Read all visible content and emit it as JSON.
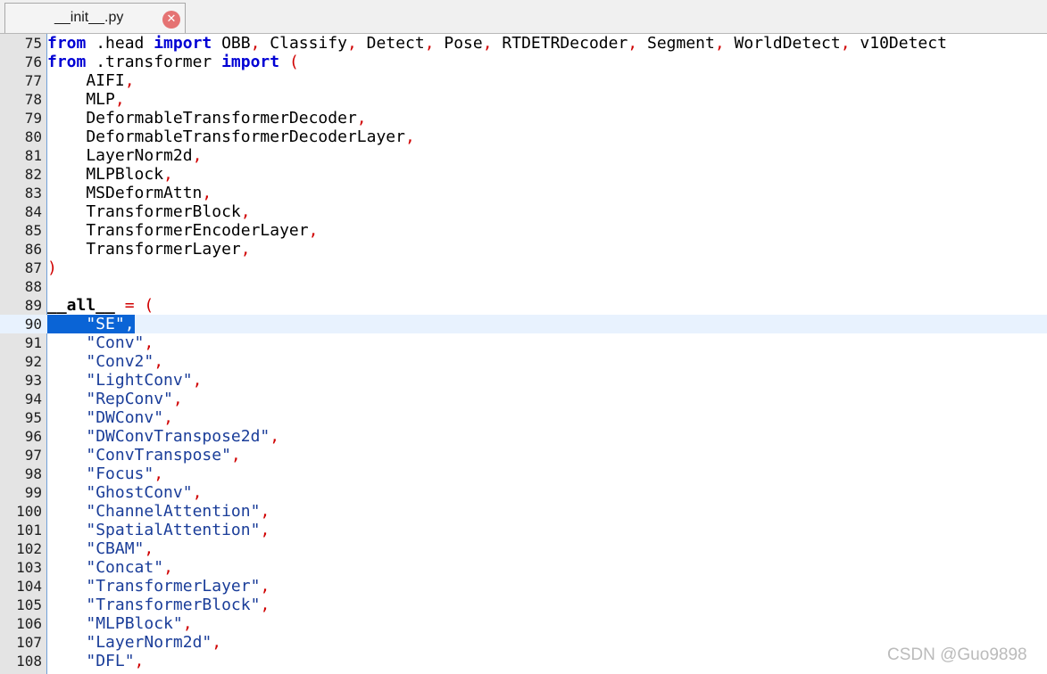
{
  "tab": {
    "title": "__init__.py",
    "close_glyph": "✕"
  },
  "lines": [
    {
      "n": "75",
      "tokens": [
        {
          "t": "from",
          "c": "kw"
        },
        {
          "t": " .head ",
          "c": ""
        },
        {
          "t": "import",
          "c": "kw"
        },
        {
          "t": " OBB",
          "c": ""
        },
        {
          "t": ",",
          "c": "op"
        },
        {
          "t": " Classify",
          "c": ""
        },
        {
          "t": ",",
          "c": "op"
        },
        {
          "t": " Detect",
          "c": ""
        },
        {
          "t": ",",
          "c": "op"
        },
        {
          "t": " Pose",
          "c": ""
        },
        {
          "t": ",",
          "c": "op"
        },
        {
          "t": " RTDETRDecoder",
          "c": ""
        },
        {
          "t": ",",
          "c": "op"
        },
        {
          "t": " Segment",
          "c": ""
        },
        {
          "t": ",",
          "c": "op"
        },
        {
          "t": " WorldDetect",
          "c": ""
        },
        {
          "t": ",",
          "c": "op"
        },
        {
          "t": " v10Detect",
          "c": ""
        }
      ]
    },
    {
      "n": "76",
      "tokens": [
        {
          "t": "from",
          "c": "kw"
        },
        {
          "t": " .transformer ",
          "c": ""
        },
        {
          "t": "import",
          "c": "kw"
        },
        {
          "t": " ",
          "c": ""
        },
        {
          "t": "(",
          "c": "op"
        }
      ]
    },
    {
      "n": "77",
      "tokens": [
        {
          "t": "    AIFI",
          "c": ""
        },
        {
          "t": ",",
          "c": "op"
        }
      ]
    },
    {
      "n": "78",
      "tokens": [
        {
          "t": "    MLP",
          "c": ""
        },
        {
          "t": ",",
          "c": "op"
        }
      ]
    },
    {
      "n": "79",
      "tokens": [
        {
          "t": "    DeformableTransformerDecoder",
          "c": ""
        },
        {
          "t": ",",
          "c": "op"
        }
      ]
    },
    {
      "n": "80",
      "tokens": [
        {
          "t": "    DeformableTransformerDecoderLayer",
          "c": ""
        },
        {
          "t": ",",
          "c": "op"
        }
      ]
    },
    {
      "n": "81",
      "tokens": [
        {
          "t": "    LayerNorm2d",
          "c": ""
        },
        {
          "t": ",",
          "c": "op"
        }
      ]
    },
    {
      "n": "82",
      "tokens": [
        {
          "t": "    MLPBlock",
          "c": ""
        },
        {
          "t": ",",
          "c": "op"
        }
      ]
    },
    {
      "n": "83",
      "tokens": [
        {
          "t": "    MSDeformAttn",
          "c": ""
        },
        {
          "t": ",",
          "c": "op"
        }
      ]
    },
    {
      "n": "84",
      "tokens": [
        {
          "t": "    TransformerBlock",
          "c": ""
        },
        {
          "t": ",",
          "c": "op"
        }
      ]
    },
    {
      "n": "85",
      "tokens": [
        {
          "t": "    TransformerEncoderLayer",
          "c": ""
        },
        {
          "t": ",",
          "c": "op"
        }
      ]
    },
    {
      "n": "86",
      "tokens": [
        {
          "t": "    TransformerLayer",
          "c": ""
        },
        {
          "t": ",",
          "c": "op"
        }
      ]
    },
    {
      "n": "87",
      "tokens": [
        {
          "t": ")",
          "c": "op"
        }
      ]
    },
    {
      "n": "88",
      "tokens": []
    },
    {
      "n": "89",
      "tokens": [
        {
          "t": "__all__",
          "c": "dunder"
        },
        {
          "t": " ",
          "c": ""
        },
        {
          "t": "=",
          "c": "op"
        },
        {
          "t": " ",
          "c": ""
        },
        {
          "t": "(",
          "c": "op"
        }
      ]
    },
    {
      "n": "90",
      "hl": true,
      "tokens": [
        {
          "t": "    \"SE\"",
          "c": "sel"
        },
        {
          "t": ",",
          "c": "sel op"
        }
      ]
    },
    {
      "n": "91",
      "tokens": [
        {
          "t": "    ",
          "c": ""
        },
        {
          "t": "\"Conv\"",
          "c": "str"
        },
        {
          "t": ",",
          "c": "op"
        }
      ]
    },
    {
      "n": "92",
      "tokens": [
        {
          "t": "    ",
          "c": ""
        },
        {
          "t": "\"Conv2\"",
          "c": "str"
        },
        {
          "t": ",",
          "c": "op"
        }
      ]
    },
    {
      "n": "93",
      "tokens": [
        {
          "t": "    ",
          "c": ""
        },
        {
          "t": "\"LightConv\"",
          "c": "str"
        },
        {
          "t": ",",
          "c": "op"
        }
      ]
    },
    {
      "n": "94",
      "tokens": [
        {
          "t": "    ",
          "c": ""
        },
        {
          "t": "\"RepConv\"",
          "c": "str"
        },
        {
          "t": ",",
          "c": "op"
        }
      ]
    },
    {
      "n": "95",
      "tokens": [
        {
          "t": "    ",
          "c": ""
        },
        {
          "t": "\"DWConv\"",
          "c": "str"
        },
        {
          "t": ",",
          "c": "op"
        }
      ]
    },
    {
      "n": "96",
      "tokens": [
        {
          "t": "    ",
          "c": ""
        },
        {
          "t": "\"DWConvTranspose2d\"",
          "c": "str"
        },
        {
          "t": ",",
          "c": "op"
        }
      ]
    },
    {
      "n": "97",
      "tokens": [
        {
          "t": "    ",
          "c": ""
        },
        {
          "t": "\"ConvTranspose\"",
          "c": "str"
        },
        {
          "t": ",",
          "c": "op"
        }
      ]
    },
    {
      "n": "98",
      "tokens": [
        {
          "t": "    ",
          "c": ""
        },
        {
          "t": "\"Focus\"",
          "c": "str"
        },
        {
          "t": ",",
          "c": "op"
        }
      ]
    },
    {
      "n": "99",
      "tokens": [
        {
          "t": "    ",
          "c": ""
        },
        {
          "t": "\"GhostConv\"",
          "c": "str"
        },
        {
          "t": ",",
          "c": "op"
        }
      ]
    },
    {
      "n": "100",
      "tokens": [
        {
          "t": "    ",
          "c": ""
        },
        {
          "t": "\"ChannelAttention\"",
          "c": "str"
        },
        {
          "t": ",",
          "c": "op"
        }
      ]
    },
    {
      "n": "101",
      "tokens": [
        {
          "t": "    ",
          "c": ""
        },
        {
          "t": "\"SpatialAttention\"",
          "c": "str"
        },
        {
          "t": ",",
          "c": "op"
        }
      ]
    },
    {
      "n": "102",
      "tokens": [
        {
          "t": "    ",
          "c": ""
        },
        {
          "t": "\"CBAM\"",
          "c": "str"
        },
        {
          "t": ",",
          "c": "op"
        }
      ]
    },
    {
      "n": "103",
      "tokens": [
        {
          "t": "    ",
          "c": ""
        },
        {
          "t": "\"Concat\"",
          "c": "str"
        },
        {
          "t": ",",
          "c": "op"
        }
      ]
    },
    {
      "n": "104",
      "tokens": [
        {
          "t": "    ",
          "c": ""
        },
        {
          "t": "\"TransformerLayer\"",
          "c": "str"
        },
        {
          "t": ",",
          "c": "op"
        }
      ]
    },
    {
      "n": "105",
      "tokens": [
        {
          "t": "    ",
          "c": ""
        },
        {
          "t": "\"TransformerBlock\"",
          "c": "str"
        },
        {
          "t": ",",
          "c": "op"
        }
      ]
    },
    {
      "n": "106",
      "tokens": [
        {
          "t": "    ",
          "c": ""
        },
        {
          "t": "\"MLPBlock\"",
          "c": "str"
        },
        {
          "t": ",",
          "c": "op"
        }
      ]
    },
    {
      "n": "107",
      "tokens": [
        {
          "t": "    ",
          "c": ""
        },
        {
          "t": "\"LayerNorm2d\"",
          "c": "str"
        },
        {
          "t": ",",
          "c": "op"
        }
      ]
    },
    {
      "n": "108",
      "tokens": [
        {
          "t": "    ",
          "c": ""
        },
        {
          "t": "\"DFL\"",
          "c": "str"
        },
        {
          "t": ",",
          "c": "op"
        }
      ]
    }
  ],
  "watermark": "CSDN @Guo9898"
}
